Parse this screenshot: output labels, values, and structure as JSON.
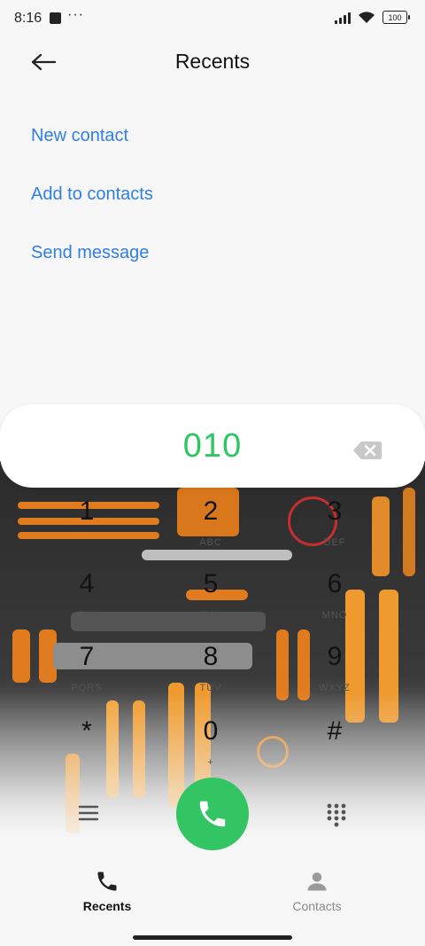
{
  "status_bar": {
    "time": "8:16",
    "more": "···",
    "battery": "100"
  },
  "header": {
    "title": "Recents",
    "back_icon": "arrow-left-icon"
  },
  "actions": [
    "New contact",
    "Add to contacts",
    "Send message"
  ],
  "dialer": {
    "number": "010"
  },
  "keypad": [
    {
      "digit": "1",
      "letters": ""
    },
    {
      "digit": "2",
      "letters": "ABC"
    },
    {
      "digit": "3",
      "letters": "DEF"
    },
    {
      "digit": "4",
      "letters": "GHI"
    },
    {
      "digit": "5",
      "letters": "JKL"
    },
    {
      "digit": "6",
      "letters": "MNO"
    },
    {
      "digit": "7",
      "letters": "PQRS"
    },
    {
      "digit": "8",
      "letters": "TUV"
    },
    {
      "digit": "9",
      "letters": "WXYZ"
    },
    {
      "digit": "*",
      "letters": ""
    },
    {
      "digit": "0",
      "letters": "+"
    },
    {
      "digit": "#",
      "letters": ""
    }
  ],
  "bottom_nav": {
    "tabs": [
      {
        "label": "Recents",
        "active": true
      },
      {
        "label": "Contacts",
        "active": false
      }
    ]
  },
  "colors": {
    "accent_link": "#2f7fe6",
    "call_green": "#33c464",
    "number_green": "#2cc665"
  }
}
